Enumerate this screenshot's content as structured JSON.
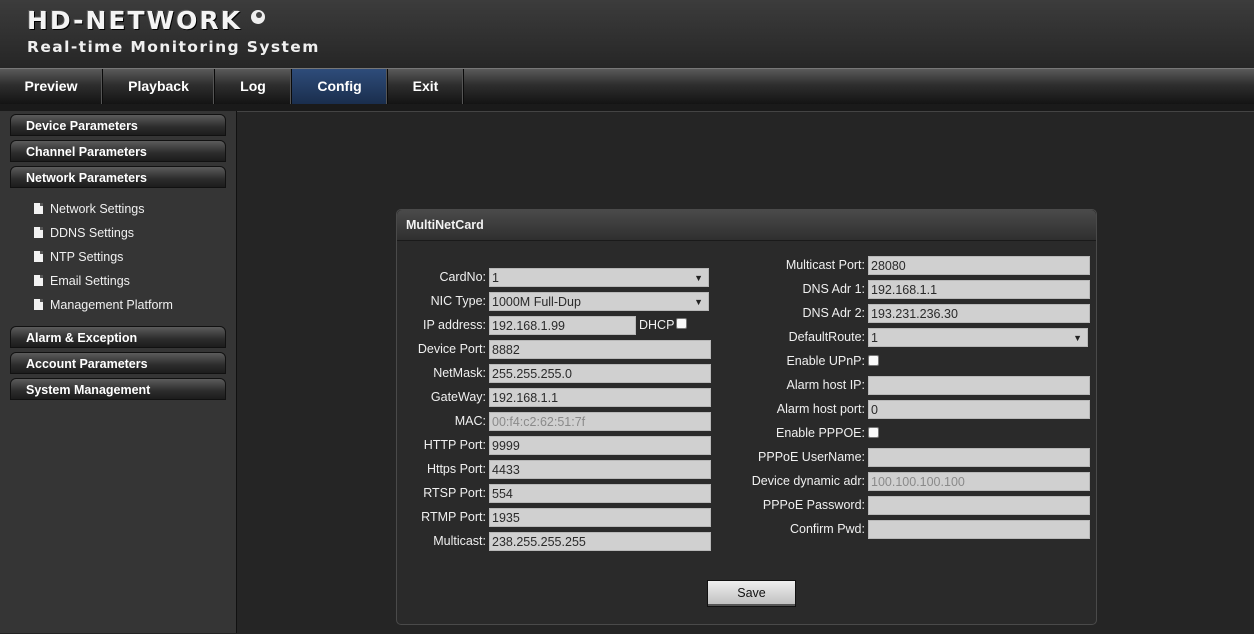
{
  "header": {
    "logo": "HD-NETWORK",
    "subtitle": "Real-time Monitoring System"
  },
  "nav": {
    "items": [
      "Preview",
      "Playback",
      "Log",
      "Config",
      "Exit"
    ],
    "active": "Config"
  },
  "sidebar": {
    "sections": [
      "Device Parameters",
      "Channel Parameters",
      "Network Parameters",
      "Alarm & Exception",
      "Account Parameters",
      "System Management"
    ],
    "sub_items": [
      "Network Settings",
      "DDNS Settings",
      "NTP Settings",
      "Email Settings",
      "Management Platform"
    ]
  },
  "panel": {
    "title": "MultiNetCard",
    "left": {
      "cardno_label": "CardNo:",
      "cardno_value": "1",
      "nictype_label": "NIC Type:",
      "nictype_value": "1000M Full-Dup",
      "ip_label": "IP address:",
      "ip_value": "192.168.1.99",
      "dhcp_label": "DHCP",
      "devport_label": "Device Port:",
      "devport_value": "8882",
      "netmask_label": "NetMask:",
      "netmask_value": "255.255.255.0",
      "gateway_label": "GateWay:",
      "gateway_value": "192.168.1.1",
      "mac_label": "MAC:",
      "mac_value": "00:f4:c2:62:51:7f",
      "http_label": "HTTP Port:",
      "http_value": "9999",
      "https_label": "Https Port:",
      "https_value": "4433",
      "rtsp_label": "RTSP Port:",
      "rtsp_value": "554",
      "rtmp_label": "RTMP Port:",
      "rtmp_value": "1935",
      "multicast_label": "Multicast:",
      "multicast_value": "238.255.255.255"
    },
    "right": {
      "mcport_label": "Multicast Port:",
      "mcport_value": "28080",
      "dns1_label": "DNS Adr 1:",
      "dns1_value": "192.168.1.1",
      "dns2_label": "DNS Adr 2:",
      "dns2_value": "193.231.236.30",
      "route_label": "DefaultRoute:",
      "route_value": "1",
      "upnp_label": "Enable UPnP:",
      "alarmip_label": "Alarm host IP:",
      "alarmip_value": "",
      "alarmport_label": "Alarm host port:",
      "alarmport_value": "0",
      "pppoe_label": "Enable PPPOE:",
      "pppoeuser_label": "PPPoE UserName:",
      "pppoeuser_value": "",
      "dynadr_label": "Device dynamic adr:",
      "dynadr_value": "100.100.100.100",
      "pppoepwd_label": "PPPoE Password:",
      "pppoepwd_value": "",
      "confirm_label": "Confirm Pwd:",
      "confirm_value": ""
    },
    "save_label": "Save"
  }
}
